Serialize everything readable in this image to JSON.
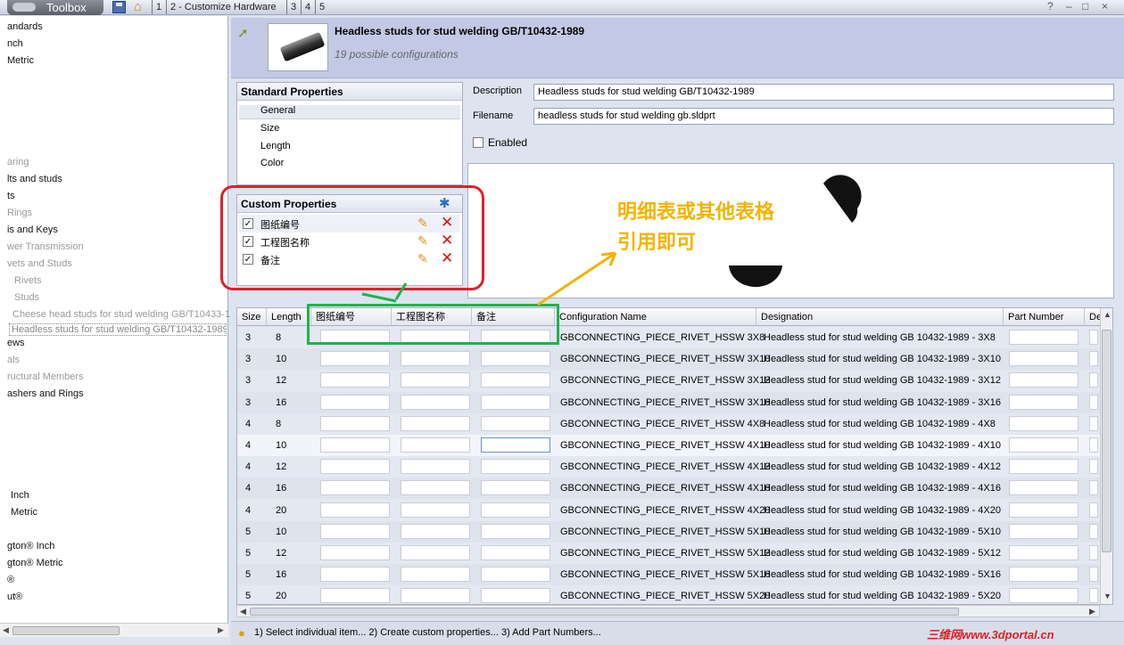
{
  "toolbar": {
    "brand": "Toolbox",
    "steps": [
      "1",
      "2 - Customize Hardware",
      "3",
      "4",
      "5"
    ],
    "controls": [
      "?",
      "–",
      "□",
      "×"
    ]
  },
  "tree": {
    "items": [
      {
        "label": "andards",
        "dim": false
      },
      {
        "label": "nch",
        "dim": false
      },
      {
        "label": "Metric",
        "dim": false
      },
      {
        "label": "aring",
        "dim": true
      },
      {
        "label": "lts and studs",
        "dim": false
      },
      {
        "label": "ts",
        "dim": false
      },
      {
        "label": "Rings",
        "dim": true
      },
      {
        "label": "is and Keys",
        "dim": false
      },
      {
        "label": "wer Transmission",
        "dim": true
      },
      {
        "label": "vets and Studs",
        "dim": true
      },
      {
        "label": "Rivets",
        "dim": true
      },
      {
        "label": "Studs",
        "dim": true
      },
      {
        "label": "Cheese head studs for stud welding GB/T10433-1",
        "dim": true
      },
      {
        "label": "Headless studs for stud welding GB/T10432-1989",
        "dim": true
      },
      {
        "label": "ews",
        "dim": false
      },
      {
        "label": "als",
        "dim": true
      },
      {
        "label": "ructural Members",
        "dim": true
      },
      {
        "label": "ashers and Rings",
        "dim": false
      },
      {
        "label": "Inch",
        "dim": false
      },
      {
        "label": "Metric",
        "dim": false
      },
      {
        "label": "gton® Inch",
        "dim": false
      },
      {
        "label": "gton® Metric",
        "dim": false
      },
      {
        "label": "®",
        "dim": false
      },
      {
        "label": "ut®",
        "dim": false
      }
    ]
  },
  "header": {
    "title": "Headless studs for stud welding GB/T10432-1989",
    "subtitle": "19 possible configurations"
  },
  "standard_properties": {
    "title": "Standard Properties",
    "items": [
      "General",
      "Size",
      "Length",
      "Color"
    ]
  },
  "custom_properties": {
    "title": "Custom Properties",
    "items": [
      {
        "label": "图纸编号",
        "checked": true
      },
      {
        "label": "工程图名称",
        "checked": true
      },
      {
        "label": "备注",
        "checked": true
      }
    ]
  },
  "form": {
    "description_label": "Description",
    "description_value": "Headless studs for stud welding GB/T10432-1989",
    "filename_label": "Filename",
    "filename_value": "headless studs for stud welding gb.sldprt",
    "enabled_label": "Enabled"
  },
  "annotation": {
    "line1": "明细表或其他表格",
    "line2": "引用即可",
    "color": "#f2b400"
  },
  "grid": {
    "columns": [
      "Size",
      "Length",
      "图纸编号",
      "工程图名称",
      "备注",
      "Configuration Name",
      "Designation",
      "Part Number",
      "De"
    ],
    "rows": [
      {
        "size": "3",
        "length": "8",
        "config": "GBCONNECTING_PIECE_RIVET_HSSW 3X8",
        "designation": "Headless stud for stud welding GB 10432-1989 - 3X8"
      },
      {
        "size": "3",
        "length": "10",
        "config": "GBCONNECTING_PIECE_RIVET_HSSW 3X10",
        "designation": "Headless stud for stud welding GB 10432-1989 - 3X10"
      },
      {
        "size": "3",
        "length": "12",
        "config": "GBCONNECTING_PIECE_RIVET_HSSW 3X12",
        "designation": "Headless stud for stud welding GB 10432-1989 - 3X12"
      },
      {
        "size": "3",
        "length": "16",
        "config": "GBCONNECTING_PIECE_RIVET_HSSW 3X16",
        "designation": "Headless stud for stud welding GB 10432-1989 - 3X16"
      },
      {
        "size": "4",
        "length": "8",
        "config": "GBCONNECTING_PIECE_RIVET_HSSW 4X8",
        "designation": "Headless stud for stud welding GB 10432-1989 - 4X8"
      },
      {
        "size": "4",
        "length": "10",
        "config": "GBCONNECTING_PIECE_RIVET_HSSW 4X10",
        "designation": "Headless stud for stud welding GB 10432-1989 - 4X10"
      },
      {
        "size": "4",
        "length": "12",
        "config": "GBCONNECTING_PIECE_RIVET_HSSW 4X12",
        "designation": "Headless stud for stud welding GB 10432-1989 - 4X12"
      },
      {
        "size": "4",
        "length": "16",
        "config": "GBCONNECTING_PIECE_RIVET_HSSW 4X16",
        "designation": "Headless stud for stud welding GB 10432-1989 - 4X16"
      },
      {
        "size": "4",
        "length": "20",
        "config": "GBCONNECTING_PIECE_RIVET_HSSW 4X20",
        "designation": "Headless stud for stud welding GB 10432-1989 - 4X20"
      },
      {
        "size": "5",
        "length": "10",
        "config": "GBCONNECTING_PIECE_RIVET_HSSW 5X10",
        "designation": "Headless stud for stud welding GB 10432-1989 - 5X10"
      },
      {
        "size": "5",
        "length": "12",
        "config": "GBCONNECTING_PIECE_RIVET_HSSW 5X12",
        "designation": "Headless stud for stud welding GB 10432-1989 - 5X12"
      },
      {
        "size": "5",
        "length": "16",
        "config": "GBCONNECTING_PIECE_RIVET_HSSW 5X16",
        "designation": "Headless stud for stud welding GB 10432-1989 - 5X16"
      },
      {
        "size": "5",
        "length": "20",
        "config": "GBCONNECTING_PIECE_RIVET_HSSW 5X20",
        "designation": "Headless stud for stud welding GB 10432-1989 - 5X20"
      }
    ]
  },
  "status": {
    "text": "1) Select individual item... 2) Create custom properties... 3) Add Part Numbers...",
    "watermark": "三维网www.3dportal.cn"
  }
}
